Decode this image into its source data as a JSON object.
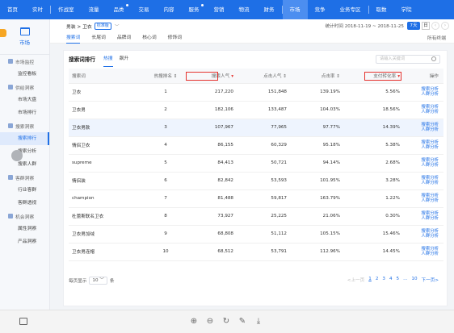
{
  "topnav": {
    "items": [
      "首页",
      "实时",
      "作战室",
      "流量",
      "品类",
      "交易",
      "内容",
      "服务",
      "营销",
      "物流",
      "财务",
      "市场",
      "竞争",
      "业务专区",
      "取数",
      "学院"
    ],
    "active_index": 11,
    "dot_indices": [
      4,
      7
    ]
  },
  "sidebar": {
    "header_label": "市场",
    "groups": [
      {
        "label": "市场监控",
        "items": [
          "监控看板"
        ]
      },
      {
        "label": "供给洞察",
        "items": [
          "市场大盘",
          "市场排行"
        ]
      },
      {
        "label": "搜索洞察",
        "items": [
          "搜索排行",
          "搜索分析",
          "搜索人群"
        ]
      },
      {
        "label": "客群洞察",
        "items": [
          "行业客群",
          "客群透视"
        ]
      },
      {
        "label": "机会洞察",
        "items": [
          "属性洞察",
          "产品洞察"
        ]
      }
    ],
    "active_item": "搜索排行"
  },
  "crumb": {
    "path": "男装 > 卫衣",
    "tag": "标准版",
    "date_range": "统计时间 2018-11-19 ~ 2018-11-25",
    "period_button": "7天",
    "day_button": "日"
  },
  "tabs": {
    "items": [
      "搜索词",
      "长尾词",
      "品牌词",
      "核心词",
      "修饰词"
    ],
    "active_index": 0,
    "right_link": "所有终端"
  },
  "card": {
    "title": "搜索词排行",
    "subtabs": [
      "热搜",
      "飙升"
    ],
    "active_subtab": 0,
    "search_placeholder": "请输入关键词"
  },
  "table": {
    "columns": [
      "搜索词",
      "热搜排名",
      "搜索人气",
      "点击人气",
      "点击率",
      "支付转化率",
      "操作"
    ],
    "rows": [
      [
        "卫衣",
        "1",
        "217,220",
        "151,848",
        "139.19%",
        "5.56%"
      ],
      [
        "卫衣男",
        "2",
        "182,106",
        "133,487",
        "104.03%",
        "18.56%"
      ],
      [
        "卫衣男款",
        "3",
        "107,967",
        "77,965",
        "97.77%",
        "14.39%"
      ],
      [
        "情侣卫衣",
        "4",
        "86,155",
        "60,329",
        "95.18%",
        "5.38%"
      ],
      [
        "supreme",
        "5",
        "84,413",
        "50,721",
        "94.14%",
        "2.68%"
      ],
      [
        "情侣装",
        "6",
        "82,842",
        "53,593",
        "101.95%",
        "3.28%"
      ],
      [
        "champion",
        "7",
        "81,488",
        "59,817",
        "163.79%",
        "1.22%"
      ],
      [
        "杜蕾斯联名卫衣",
        "8",
        "73,927",
        "25,225",
        "21.06%",
        "0.30%"
      ],
      [
        "卫衣男加绒",
        "9",
        "68,808",
        "51,112",
        "105.15%",
        "15.46%"
      ],
      [
        "卫衣男连帽",
        "10",
        "68,512",
        "53,791",
        "112.96%",
        "14.45%"
      ]
    ],
    "op_line1": "搜索分析",
    "op_line2": "人群分析",
    "highlight_row": 2
  },
  "footer": {
    "per_page_label": "每页显示",
    "per_page_value": "10",
    "per_page_unit": "条",
    "prev": "<上一页",
    "pages": [
      "1",
      "2",
      "3",
      "4",
      "5",
      "...",
      "10"
    ],
    "next": "下一页>"
  },
  "bottombar": {
    "tools": [
      "⊕",
      "⊖",
      "↻",
      "✎",
      "⤓"
    ]
  }
}
